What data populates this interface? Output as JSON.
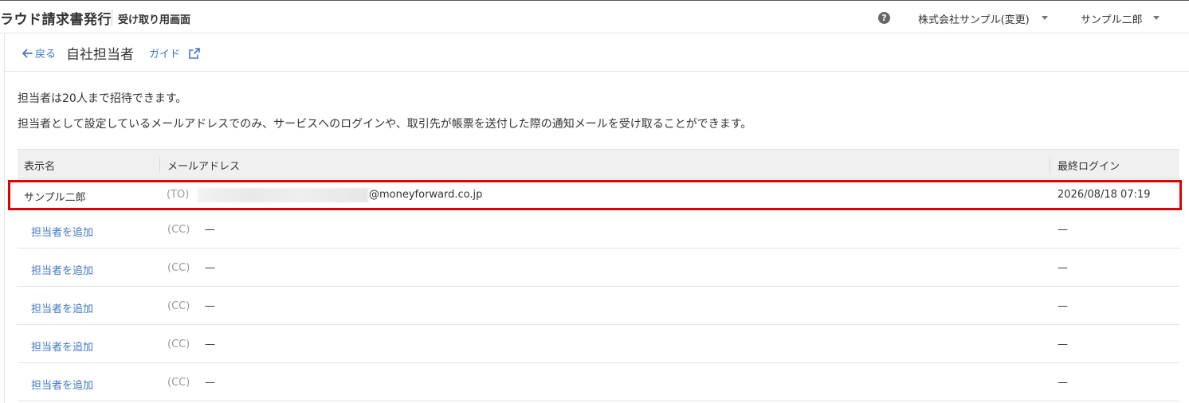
{
  "header": {
    "app_title": "ラウド請求書発行",
    "app_subtitle": "受け取り用画面",
    "help_symbol": "?",
    "company": "株式会社サンプル(変更)",
    "user": "サンプル二郎"
  },
  "subheader": {
    "back_label": "戻る",
    "page_title": "自社担当者",
    "guide_label": "ガイド"
  },
  "description": {
    "line1": "担当者は20人まで招待できます。",
    "line2": "担当者として設定しているメールアドレスでのみ、サービスへのログインや、取引先が帳票を送付した際の通知メールを受け取ることができます。"
  },
  "table": {
    "columns": {
      "name": "表示名",
      "email": "メールアドレス",
      "last_login": "最終ログイン"
    },
    "rows": [
      {
        "name": "サンプル二郎",
        "type": "(TO)",
        "email_domain": "@moneyforward.co.jp",
        "last_login": "2026/08/18 07:19"
      },
      {
        "name": "担当者を追加",
        "type": "(CC)",
        "email": "—",
        "last_login": "—"
      },
      {
        "name": "担当者を追加",
        "type": "(CC)",
        "email": "—",
        "last_login": "—"
      },
      {
        "name": "担当者を追加",
        "type": "(CC)",
        "email": "—",
        "last_login": "—"
      },
      {
        "name": "担当者を追加",
        "type": "(CC)",
        "email": "—",
        "last_login": "—"
      },
      {
        "name": "担当者を追加",
        "type": "(CC)",
        "email": "—",
        "last_login": "—"
      }
    ]
  },
  "colors": {
    "link": "#3f78c5",
    "highlight_border": "#e00000",
    "header_bg": "#f0f0f0"
  },
  "icons": [
    "help-icon",
    "chevron-down-icon",
    "arrow-left-icon",
    "external-link-icon"
  ]
}
